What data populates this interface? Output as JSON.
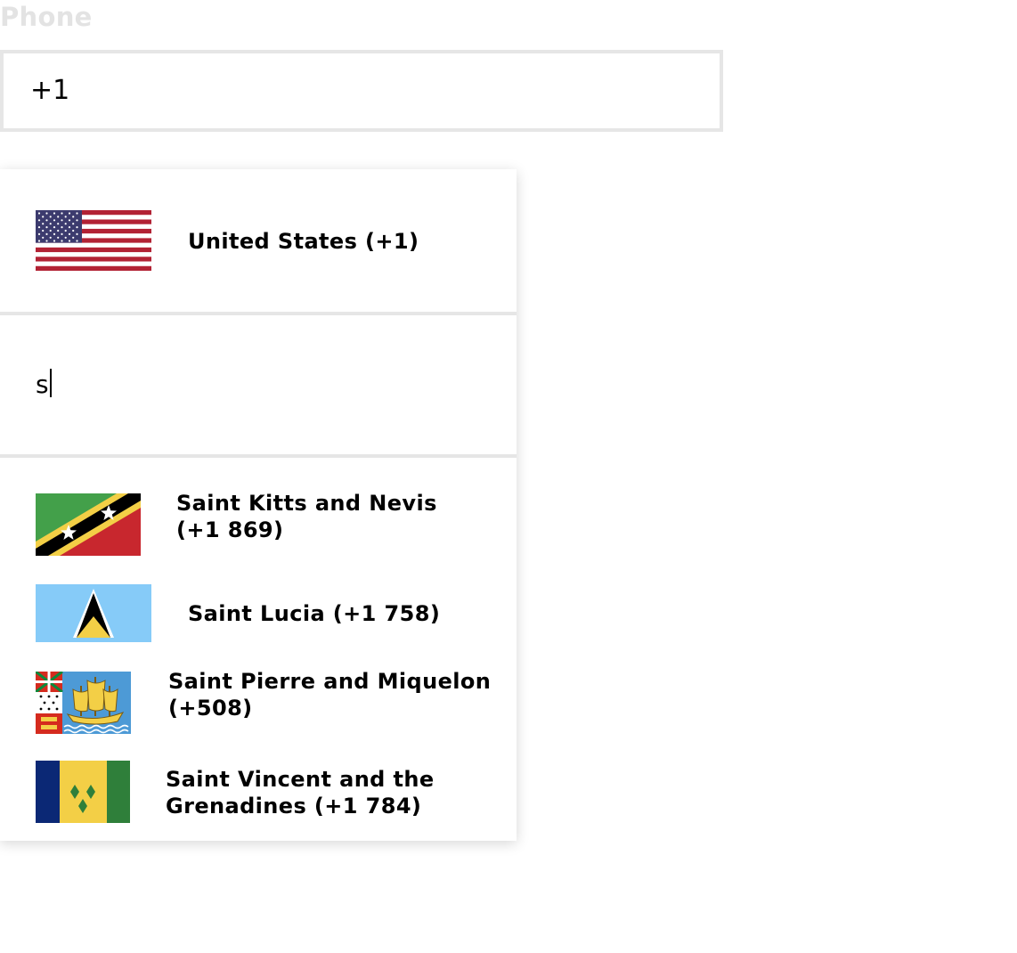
{
  "phone": {
    "label": "Phone",
    "value": "+1"
  },
  "dropdown": {
    "selected": {
      "name": "United States (+1)",
      "flag": "us-flag-icon"
    },
    "search": {
      "value": "s"
    },
    "options": [
      {
        "label": "Saint Kitts and Nevis (+1 869)",
        "flag": "kn-flag-icon"
      },
      {
        "label": "Saint Lucia (+1 758)",
        "flag": "lc-flag-icon"
      },
      {
        "label": "Saint Pierre and Miquelon (+508)",
        "flag": "pm-flag-icon"
      },
      {
        "label": "Saint Vincent and the Grenadines (+1 784)",
        "flag": "vc-flag-icon"
      }
    ]
  }
}
